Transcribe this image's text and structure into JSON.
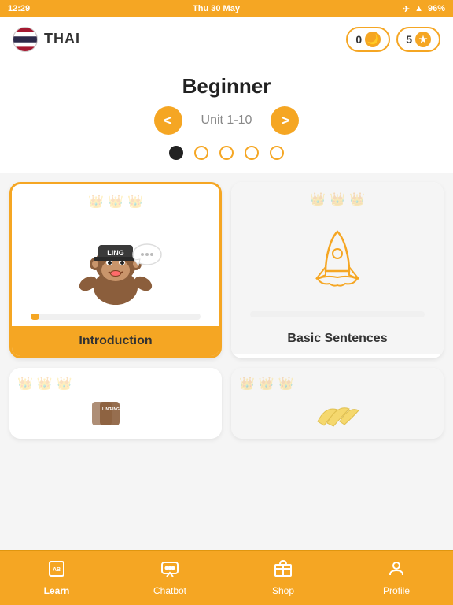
{
  "statusBar": {
    "time": "12:29",
    "day": "Thu 30 May",
    "battery": "96%"
  },
  "header": {
    "appName": "THAI",
    "streakCount": "0",
    "starCount": "5"
  },
  "levelSection": {
    "levelTitle": "Beginner",
    "unitLabel": "Unit 1-10",
    "prevBtn": "<",
    "nextBtn": ">"
  },
  "cards": [
    {
      "id": "introduction",
      "label": "Introduction",
      "highlighted": true,
      "progressPct": 5
    },
    {
      "id": "basic-sentences",
      "label": "Basic Sentences",
      "highlighted": false,
      "progressPct": 0
    }
  ],
  "bottomNav": [
    {
      "id": "learn",
      "label": "Learn",
      "icon": "AB",
      "active": true
    },
    {
      "id": "chatbot",
      "label": "Chatbot",
      "icon": "💬",
      "active": false
    },
    {
      "id": "shop",
      "label": "Shop",
      "icon": "🏪",
      "active": false
    },
    {
      "id": "profile",
      "label": "Profile",
      "icon": "👤",
      "active": false
    }
  ]
}
